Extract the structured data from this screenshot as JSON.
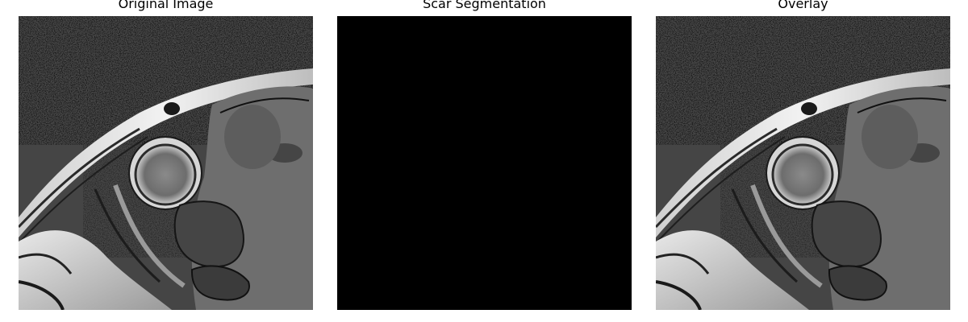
{
  "panels": [
    {
      "title": "Original Image",
      "kind": "mri-slice"
    },
    {
      "title": "Scar Segmentation",
      "kind": "empty-mask"
    },
    {
      "title": "Overlay",
      "kind": "mri-slice-overlay"
    }
  ],
  "colors": {
    "background": "#ffffff",
    "mri_background": "#454545",
    "mask_background": "#000000"
  }
}
